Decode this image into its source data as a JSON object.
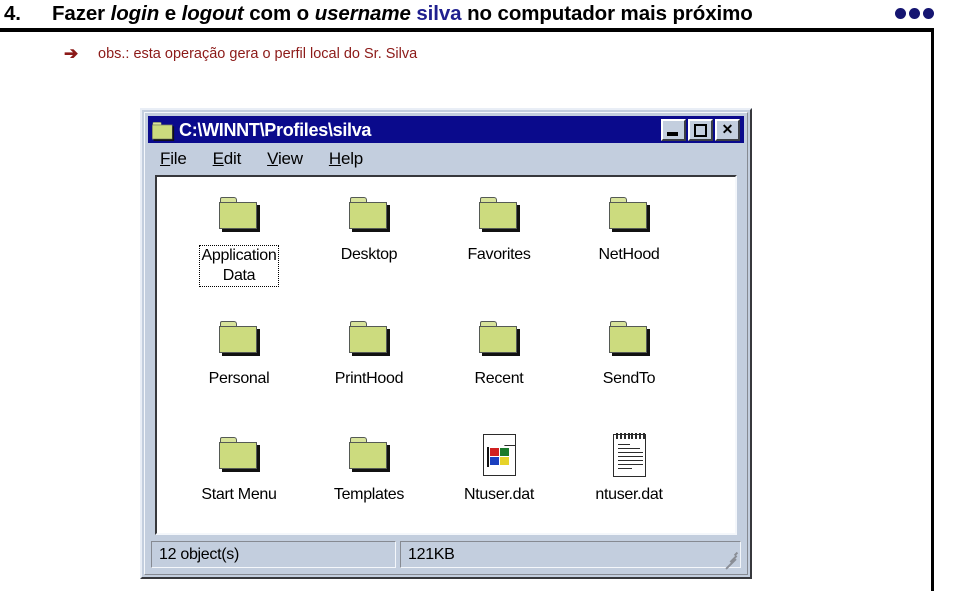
{
  "slide": {
    "number": "4.",
    "title_parts": [
      {
        "text": "Fazer ",
        "style": "normal"
      },
      {
        "text": "login",
        "style": "italic"
      },
      {
        "text": " e ",
        "style": "normal"
      },
      {
        "text": "logout",
        "style": "italic"
      },
      {
        "text": " com o ",
        "style": "normal"
      },
      {
        "text": "username",
        "style": "italic"
      },
      {
        "text": " ",
        "style": "normal"
      },
      {
        "text": "silva",
        "style": "blue"
      },
      {
        "text": " no computador mais próximo",
        "style": "normal"
      }
    ],
    "title_plain": "4. Fazer login e logout com o username silva no computador mais próximo",
    "bullet_dots_count": 3,
    "bullet_dots_color": "#151571",
    "note": {
      "arrow_icon": "arrow-right-icon",
      "arrow_glyph": "➔",
      "text": "obs.:  esta operação gera o perfil local do Sr. Silva",
      "color": "#8c1a18"
    }
  },
  "window": {
    "title": "C:\\WINNT\\Profiles\\silva",
    "title_icon": "open-folder-icon",
    "titlebar_color": "#0a0a8c",
    "chrome_color": "#c3cede",
    "controls": {
      "minimize": "minimize-button",
      "maximize": "maximize-button",
      "close_glyph": "✕"
    },
    "menu": [
      {
        "accel": "F",
        "rest": "ile"
      },
      {
        "accel": "E",
        "rest": "dit"
      },
      {
        "accel": "V",
        "rest": "iew"
      },
      {
        "accel": "H",
        "rest": "elp"
      }
    ],
    "items": [
      {
        "label": "Application\nData",
        "icon": "folder-icon",
        "focused": true,
        "col": 0,
        "row": 0
      },
      {
        "label": "Desktop",
        "icon": "folder-icon",
        "focused": false,
        "col": 1,
        "row": 0
      },
      {
        "label": "Favorites",
        "icon": "folder-icon",
        "focused": false,
        "col": 2,
        "row": 0
      },
      {
        "label": "NetHood",
        "icon": "folder-icon",
        "focused": false,
        "col": 3,
        "row": 0
      },
      {
        "label": "Personal",
        "icon": "folder-icon",
        "focused": false,
        "col": 0,
        "row": 1
      },
      {
        "label": "PrintHood",
        "icon": "folder-icon",
        "focused": false,
        "col": 1,
        "row": 1
      },
      {
        "label": "Recent",
        "icon": "folder-icon",
        "focused": false,
        "col": 2,
        "row": 1
      },
      {
        "label": "SendTo",
        "icon": "folder-icon",
        "focused": false,
        "col": 3,
        "row": 1
      },
      {
        "label": "Start Menu",
        "icon": "folder-icon",
        "focused": false,
        "col": 0,
        "row": 2
      },
      {
        "label": "Templates",
        "icon": "folder-icon",
        "focused": false,
        "col": 1,
        "row": 2
      },
      {
        "label": "Ntuser.dat",
        "icon": "windows-document-icon",
        "focused": false,
        "col": 2,
        "row": 2
      },
      {
        "label": "ntuser.dat",
        "icon": "notepad-document-icon",
        "focused": false,
        "col": 3,
        "row": 2
      }
    ],
    "status": {
      "objects": "12 object(s)",
      "size": "121KB",
      "grip_icon": "resize-grip-icon"
    }
  }
}
